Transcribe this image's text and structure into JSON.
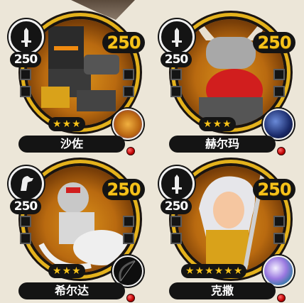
{
  "cards": [
    {
      "name": "沙佐",
      "level": "250",
      "cost": "250",
      "stars": 3,
      "weapon_icon": "sword-icon",
      "badge": "lion-emblem"
    },
    {
      "name": "赫尔玛",
      "level": "250",
      "cost": "250",
      "stars": 3,
      "weapon_icon": "sword-icon",
      "badge": "horn-item"
    },
    {
      "name": "希尔达",
      "level": "250",
      "cost": "250",
      "stars": 3,
      "weapon_icon": "horse-icon",
      "badge": "bow-item"
    },
    {
      "name": "克撒",
      "level": "250",
      "cost": "250",
      "stars": 6,
      "weapon_icon": "sword-icon",
      "badge": "orb-item"
    }
  ],
  "colors": {
    "gold": "#f6c21a",
    "frame": "#e4b21c",
    "badge_bg": "#141414",
    "dot": "#c00000"
  }
}
